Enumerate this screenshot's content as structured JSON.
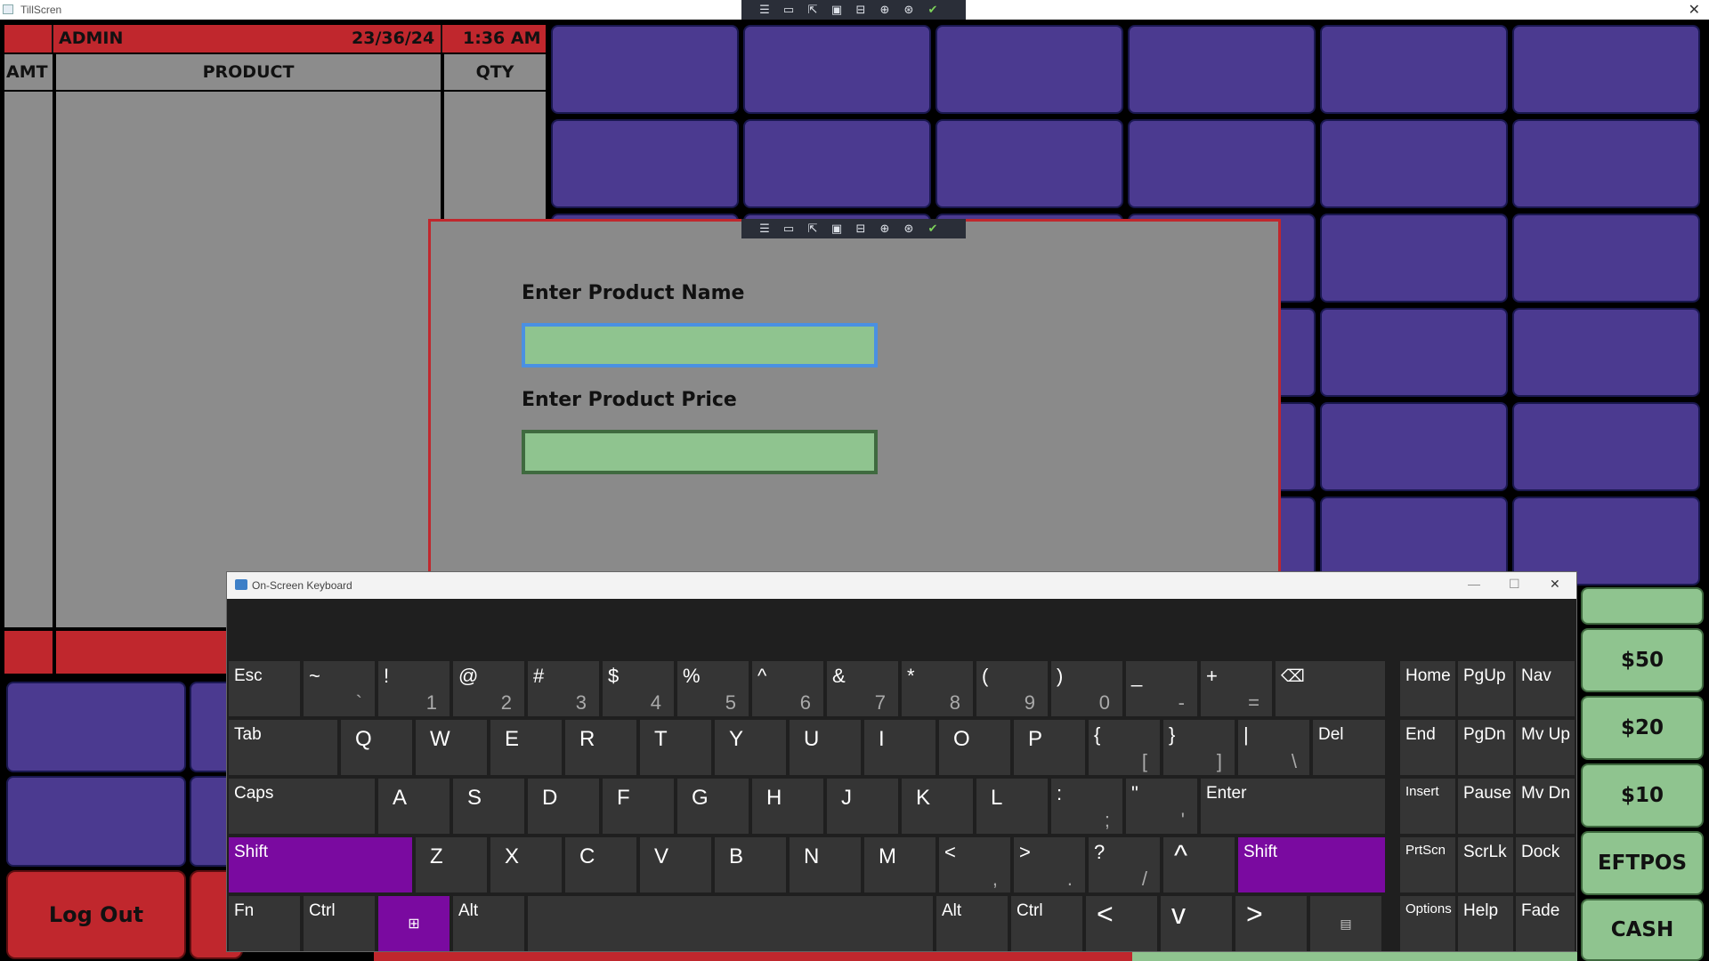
{
  "window": {
    "title": "TillScren"
  },
  "header": {
    "user": "ADMIN",
    "date": "23/36/24",
    "time": "1:36 AM"
  },
  "columns": {
    "amt": "AMT",
    "product": "PRODUCT",
    "qty": "QTY"
  },
  "buttons": {
    "logout": "Log Out"
  },
  "payment": [
    "$50",
    "$20",
    "$10",
    "EFTPOS",
    "CASH"
  ],
  "dialog": {
    "name_label": "Enter Product Name",
    "name_value": "",
    "price_label": "Enter Product Price",
    "price_value": ""
  },
  "osk": {
    "title": "On-Screen Keyboard",
    "row1": [
      {
        "t": "Esc"
      },
      {
        "t": "~",
        "b": "`"
      },
      {
        "t": "!",
        "b": "1"
      },
      {
        "t": "@",
        "b": "2"
      },
      {
        "t": "#",
        "b": "3"
      },
      {
        "t": "$",
        "b": "4"
      },
      {
        "t": "%",
        "b": "5"
      },
      {
        "t": "^",
        "b": "6"
      },
      {
        "t": "&",
        "b": "7"
      },
      {
        "t": "*",
        "b": "8"
      },
      {
        "t": "(",
        "b": "9"
      },
      {
        "t": ")",
        "b": "0"
      },
      {
        "t": "_",
        "b": "-"
      },
      {
        "t": "+",
        "b": "="
      },
      {
        "t": "⌫"
      }
    ],
    "row2": [
      {
        "t": "Tab"
      },
      {
        "m": "Q"
      },
      {
        "m": "W"
      },
      {
        "m": "E"
      },
      {
        "m": "R"
      },
      {
        "m": "T"
      },
      {
        "m": "Y"
      },
      {
        "m": "U"
      },
      {
        "m": "I"
      },
      {
        "m": "O"
      },
      {
        "m": "P"
      },
      {
        "t": "{",
        "b": "["
      },
      {
        "t": "}",
        "b": "]"
      },
      {
        "t": "|",
        "b": "\\"
      },
      {
        "t": "Del"
      }
    ],
    "row3": [
      {
        "t": "Caps"
      },
      {
        "m": "A"
      },
      {
        "m": "S"
      },
      {
        "m": "D"
      },
      {
        "m": "F"
      },
      {
        "m": "G"
      },
      {
        "m": "H"
      },
      {
        "m": "J"
      },
      {
        "m": "K"
      },
      {
        "m": "L"
      },
      {
        "t": ":",
        "b": ";"
      },
      {
        "t": "\"",
        "b": "'"
      },
      {
        "t": "Enter"
      }
    ],
    "row4": [
      {
        "t": "Shift"
      },
      {
        "m": "Z"
      },
      {
        "m": "X"
      },
      {
        "m": "C"
      },
      {
        "m": "V"
      },
      {
        "m": "B"
      },
      {
        "m": "N"
      },
      {
        "m": "M"
      },
      {
        "t": "<",
        "b": ","
      },
      {
        "t": ">",
        "b": "."
      },
      {
        "t": "?",
        "b": "/"
      },
      {
        "a": "^"
      },
      {
        "t": "Shift"
      }
    ],
    "row5": [
      {
        "t": "Fn"
      },
      {
        "t": "Ctrl"
      },
      {
        "w": "⊞"
      },
      {
        "t": "Alt"
      },
      {
        "t": ""
      },
      {
        "t": "Alt"
      },
      {
        "t": "Ctrl"
      },
      {
        "a": "<"
      },
      {
        "a": "v"
      },
      {
        "a": ">"
      },
      {
        "c": "▤"
      }
    ],
    "nav": [
      [
        "Home",
        "PgUp",
        "Nav"
      ],
      [
        "End",
        "PgDn",
        "Mv Up"
      ],
      [
        "Insert",
        "Pause",
        "Mv Dn"
      ],
      [
        "PrtScn",
        "ScrLk",
        "Dock"
      ],
      [
        "Options",
        "Help",
        "Fade"
      ]
    ]
  }
}
